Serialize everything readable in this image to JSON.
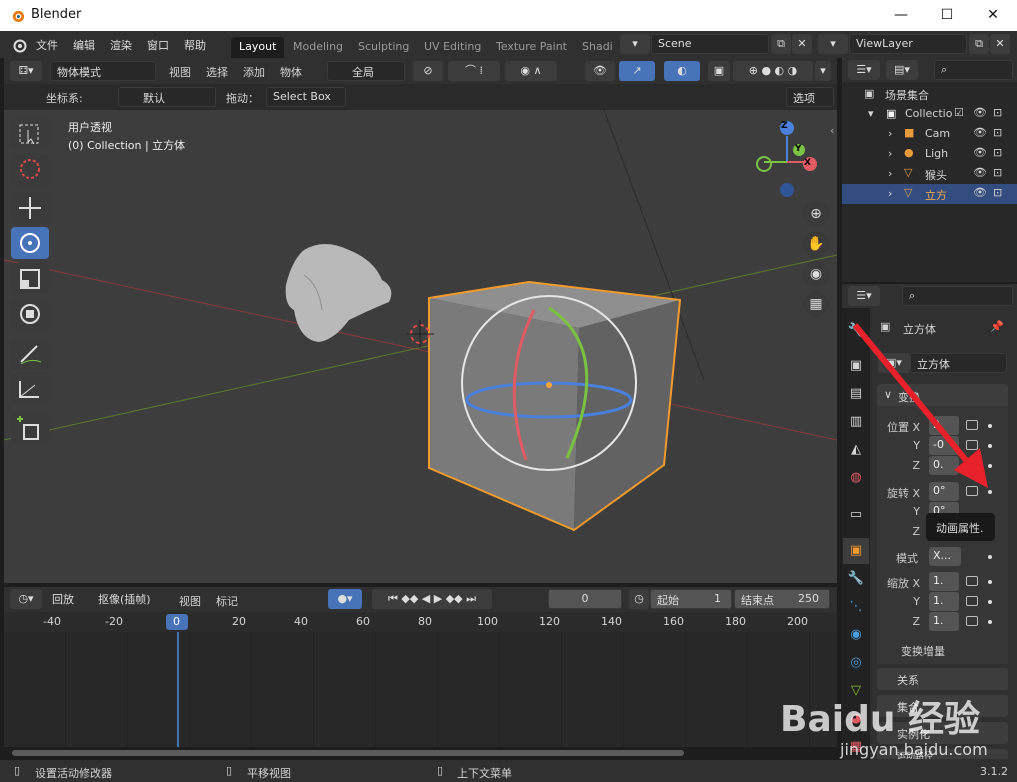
{
  "window": {
    "title": "Blender"
  },
  "menu": [
    "文件",
    "编辑",
    "渲染",
    "窗口",
    "帮助"
  ],
  "workspaces": [
    "Layout",
    "Modeling",
    "Sculpting",
    "UV Editing",
    "Texture Paint",
    "Shadi"
  ],
  "scene": "Scene",
  "view_layer": "ViewLayer",
  "viewport": {
    "mode": "物体模式",
    "menus": [
      "视图",
      "选择",
      "添加",
      "物体"
    ],
    "pivot": "全局",
    "coord_label": "坐标系:",
    "coord_value": "默认",
    "drag_label": "拖动：",
    "drag_value": "Select Box",
    "options": "选项",
    "overlay_title": "用户透视",
    "overlay_sub": "(0) Collection | 立方体",
    "gizmo": {
      "z": "Z",
      "y": "Y",
      "x": "X"
    }
  },
  "timeline": {
    "menus": [
      "回放",
      "抠像(插帧)",
      "视图",
      "标记"
    ],
    "current": "0",
    "start_label": "起始",
    "start": "1",
    "end_label": "结束点",
    "end": "250",
    "ticks": [
      "-40",
      "-20",
      "0",
      "20",
      "40",
      "60",
      "80",
      "100",
      "120",
      "140",
      "160",
      "180",
      "200"
    ]
  },
  "outliner": {
    "root": "场景集合",
    "items": [
      {
        "label": "Collectio",
        "icon": "collection-icon"
      },
      {
        "label": "Cam",
        "icon": "camera-icon"
      },
      {
        "label": "Ligh",
        "icon": "light-icon"
      },
      {
        "label": "猴头",
        "icon": "mesh-icon"
      },
      {
        "label": "立方",
        "icon": "mesh-icon"
      }
    ]
  },
  "properties": {
    "object": "立方体",
    "data_name": "立方体",
    "panel_transform": "变换",
    "location": {
      "label": "位置 X",
      "x": "2.",
      "y": "-0",
      "z": "0."
    },
    "rotation": {
      "label": "旋转 X",
      "x": "0°",
      "y": "0°"
    },
    "mode_label": "模式",
    "mode_value": "X...",
    "scale": {
      "label": "缩放 X",
      "x": "1.",
      "y": "1.",
      "z": "1."
    },
    "axis_y": "Y",
    "axis_z": "Z",
    "tooltip": "动画属性.",
    "delta": "变换增量",
    "relations": "关系",
    "collections": "集合",
    "instancing": "实例化",
    "motion": "运动路径"
  },
  "status": {
    "left": "设置活动修改器",
    "mid": "平移视图",
    "right": "上下文菜单",
    "version": "3.1.2"
  },
  "watermark": {
    "text": "Baidu 经验",
    "url": "jingyan.baidu.com"
  }
}
